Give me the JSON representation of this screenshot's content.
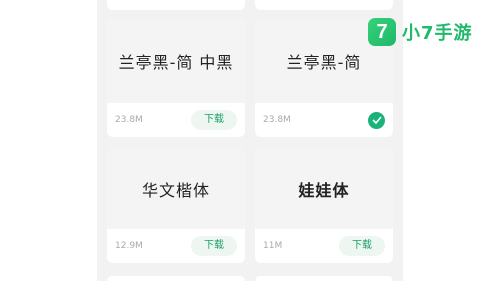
{
  "fonts": [
    {
      "name": "兰亭黑-简 中黑",
      "size": "23.8M",
      "action": "下载",
      "downloaded": false
    },
    {
      "name": "兰亭黑-简",
      "size": "23.8M",
      "action": "",
      "downloaded": true
    },
    {
      "name": "华文楷体",
      "size": "12.9M",
      "action": "下载",
      "downloaded": false
    },
    {
      "name": "娃娃体",
      "size": "11M",
      "action": "下载",
      "downloaded": false
    }
  ],
  "watermark": {
    "icon_char": "7",
    "text": "小7手游"
  },
  "colors": {
    "accent": "#1aa167",
    "check": "#19b27a",
    "watermark": "#1fba6a"
  }
}
